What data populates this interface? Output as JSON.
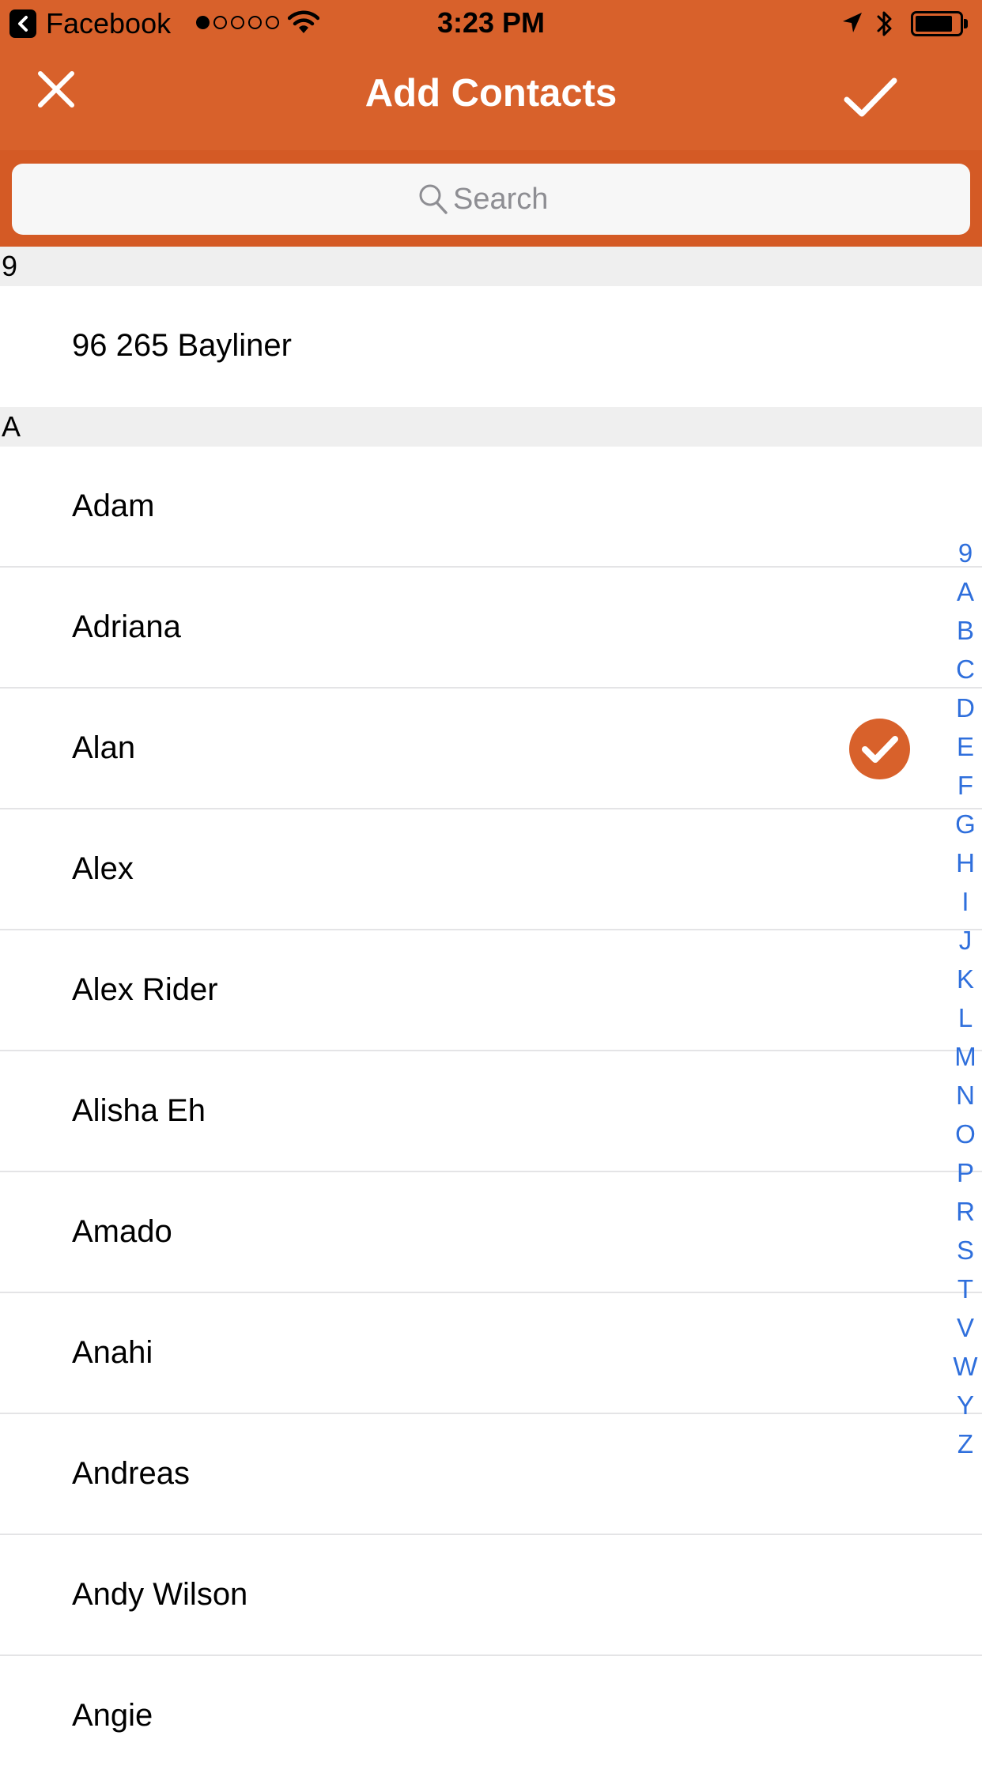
{
  "status_bar": {
    "back_app": "Facebook",
    "time": "3:23 PM",
    "signal_dots": 5,
    "signal_filled": 1,
    "battery_level": 0.85
  },
  "nav": {
    "title": "Add Contacts",
    "close_icon": "close-icon",
    "done_icon": "checkmark-icon"
  },
  "search": {
    "placeholder": "Search"
  },
  "sections": [
    {
      "header": "9",
      "contacts": [
        {
          "name": "96 265 Bayliner",
          "selected": false
        }
      ]
    },
    {
      "header": "A",
      "contacts": [
        {
          "name": "Adam",
          "selected": false
        },
        {
          "name": "Adriana",
          "selected": false
        },
        {
          "name": "Alan",
          "selected": true
        },
        {
          "name": "Alex",
          "selected": false
        },
        {
          "name": "Alex Rider",
          "selected": false
        },
        {
          "name": "Alisha Eh",
          "selected": false
        },
        {
          "name": "Amado",
          "selected": false
        },
        {
          "name": "Anahi",
          "selected": false
        },
        {
          "name": "Andreas",
          "selected": false
        },
        {
          "name": "Andy Wilson",
          "selected": false
        },
        {
          "name": "Angie",
          "selected": false
        }
      ]
    }
  ],
  "index_letters": [
    "9",
    "A",
    "B",
    "C",
    "D",
    "E",
    "F",
    "G",
    "H",
    "I",
    "J",
    "K",
    "L",
    "M",
    "N",
    "O",
    "P",
    "R",
    "S",
    "T",
    "V",
    "W",
    "Y",
    "Z"
  ],
  "colors": {
    "accent": "#d8612b",
    "index_text": "#2f6fdc",
    "section_bg": "#efefef",
    "separator": "#e4e4e6"
  }
}
